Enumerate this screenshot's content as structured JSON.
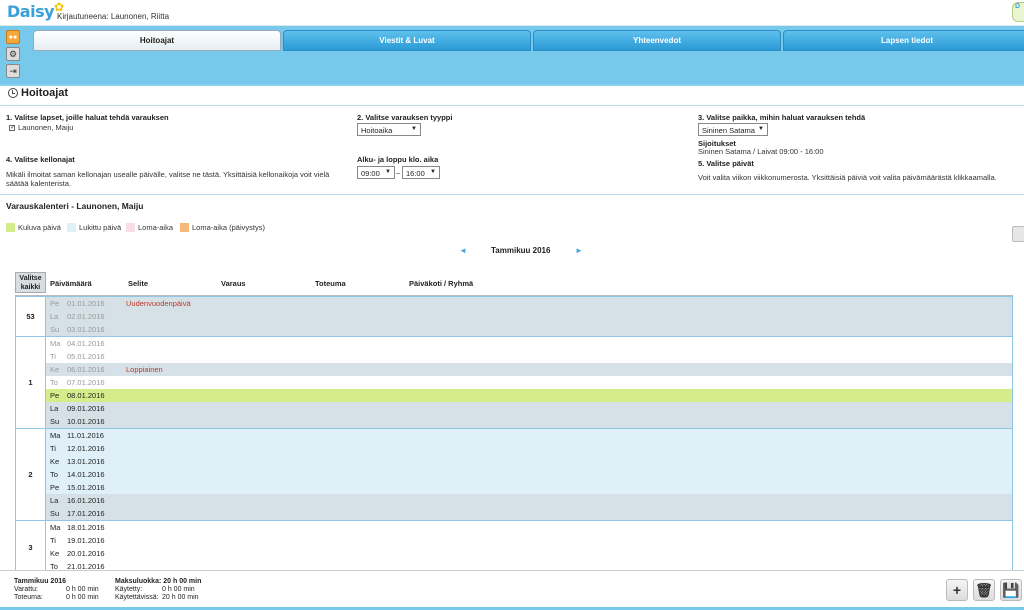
{
  "app": {
    "logo": "Daisy",
    "logged_in": "Kirjautuneena: Launonen, Riitta",
    "corner": "D"
  },
  "tabs": [
    "Hoitoajat",
    "Viestit & Luvat",
    "Yhteenvedot",
    "Lapsen tiedot"
  ],
  "page": {
    "title": "Hoitoajat"
  },
  "form": {
    "step1_label": "1. Valitse lapset, joille haluat tehdä varauksen",
    "child_name": "Launonen, Maiju",
    "step2_label": "2. Valitse varauksen tyyppi",
    "type_value": "Hoitoaika",
    "step3_label": "3. Valitse paikka, mihin haluat varauksen tehdä",
    "place_value": "Sininen Satama",
    "placements_label": "Sijoitukset",
    "placements_text": "Sininen Satama / Laivat 09:00 - 16:00",
    "step4_label": "4. Valitse kellonajat",
    "step4_text": "Mikäli ilmoitat saman kellonajan usealle päivälle, valitse ne tästä. Yksittäisiä kellonaikoja voit vielä säätää kalenterista.",
    "time_label": "Alku- ja loppu klo. aika",
    "start_time": "09:00",
    "time_sep": "–",
    "end_time": "16:00",
    "step5_label": "5. Valitse päivät",
    "step5_text": "Voit valita viikon viikkonumerosta. Yksittäisiä päiviä voit valita päivämäärästä klikkaamalla."
  },
  "calendar": {
    "title": "Varauskalenteri - Launonen, Maiju",
    "legend": [
      {
        "label": "Kuluva päivä",
        "color": "#d4ec8a"
      },
      {
        "label": "Lukittu päivä",
        "color": "#dff0f8"
      },
      {
        "label": "Loma-aika",
        "color": "#f8dde8"
      },
      {
        "label": "Loma-aika (päivystys)",
        "color": "#f7b77a"
      }
    ],
    "month": "Tammikuu 2016",
    "prev_arrow": "◄",
    "next_arrow": "►",
    "select_all": "Valitse kaikki",
    "headers": [
      "Päivämäärä",
      "Selite",
      "Varaus",
      "Toteuma",
      "Päiväkoti / Ryhmä"
    ],
    "weeks": [
      {
        "num": "53",
        "days": [
          {
            "dn": "Pe",
            "date": "01.01.2016",
            "note": "Uudenvuodenpäivä",
            "kind": "holiday"
          },
          {
            "dn": "La",
            "date": "02.01.2016",
            "note": "",
            "kind": "holiday"
          },
          {
            "dn": "Su",
            "date": "03.01.2016",
            "note": "",
            "kind": "holiday"
          }
        ]
      },
      {
        "num": "1",
        "days": [
          {
            "dn": "Ma",
            "date": "04.01.2016",
            "note": "",
            "kind": "past-locked"
          },
          {
            "dn": "Ti",
            "date": "05.01.2016",
            "note": "",
            "kind": "past-locked"
          },
          {
            "dn": "Ke",
            "date": "06.01.2016",
            "note": "Loppiainen",
            "kind": "holiday"
          },
          {
            "dn": "To",
            "date": "07.01.2016",
            "note": "",
            "kind": "past-locked"
          },
          {
            "dn": "Pe",
            "date": "08.01.2016",
            "note": "",
            "kind": "today"
          },
          {
            "dn": "La",
            "date": "09.01.2016",
            "note": "",
            "kind": "weekend"
          },
          {
            "dn": "Su",
            "date": "10.01.2016",
            "note": "",
            "kind": "weekend"
          }
        ]
      },
      {
        "num": "2",
        "days": [
          {
            "dn": "Ma",
            "date": "11.01.2016",
            "note": "",
            "kind": "locked"
          },
          {
            "dn": "Ti",
            "date": "12.01.2016",
            "note": "",
            "kind": "locked"
          },
          {
            "dn": "Ke",
            "date": "13.01.2016",
            "note": "",
            "kind": "locked"
          },
          {
            "dn": "To",
            "date": "14.01.2016",
            "note": "",
            "kind": "locked"
          },
          {
            "dn": "Pe",
            "date": "15.01.2016",
            "note": "",
            "kind": "locked"
          },
          {
            "dn": "La",
            "date": "16.01.2016",
            "note": "",
            "kind": "weekend"
          },
          {
            "dn": "Su",
            "date": "17.01.2016",
            "note": "",
            "kind": "weekend"
          }
        ]
      },
      {
        "num": "3",
        "days": [
          {
            "dn": "Ma",
            "date": "18.01.2016",
            "note": "",
            "kind": "future"
          },
          {
            "dn": "Ti",
            "date": "19.01.2016",
            "note": "",
            "kind": "future"
          },
          {
            "dn": "Ke",
            "date": "20.01.2016",
            "note": "",
            "kind": "future"
          },
          {
            "dn": "To",
            "date": "21.01.2016",
            "note": "",
            "kind": "future"
          }
        ]
      }
    ]
  },
  "footer": {
    "month": "Tammikuu 2016",
    "varattu_label": "Varattu:",
    "varattu_value": "0 h 00 min",
    "toteuma_label": "Toteuma:",
    "toteuma_value": "0 h 00 min",
    "maksuluokka": "Maksuluokka: 20 h 00 min",
    "kaytetty_label": "Käytetty:",
    "kaytetty_value": "0 h 00 min",
    "kaytettavissa_label": "Käytettävissä:",
    "kaytettavissa_value": "20 h 00 min"
  }
}
